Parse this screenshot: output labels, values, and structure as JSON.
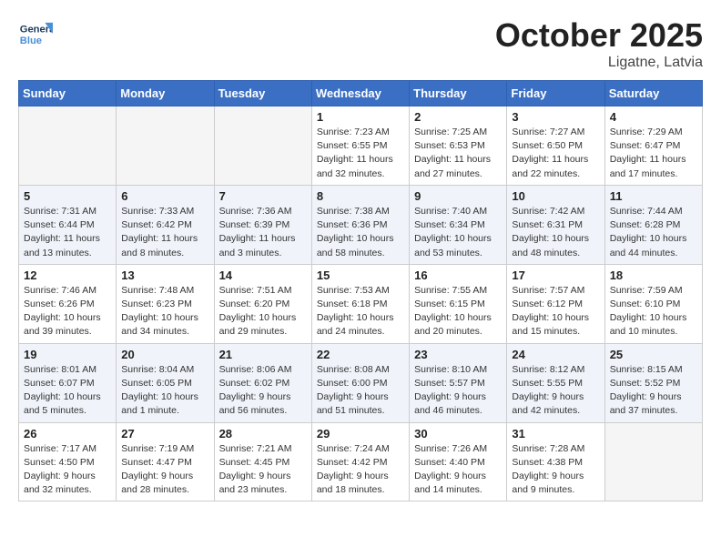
{
  "header": {
    "logo_general": "General",
    "logo_blue": "Blue",
    "month": "October 2025",
    "location": "Ligatne, Latvia"
  },
  "weekdays": [
    "Sunday",
    "Monday",
    "Tuesday",
    "Wednesday",
    "Thursday",
    "Friday",
    "Saturday"
  ],
  "weeks": [
    [
      {
        "day": "",
        "info": ""
      },
      {
        "day": "",
        "info": ""
      },
      {
        "day": "",
        "info": ""
      },
      {
        "day": "1",
        "info": "Sunrise: 7:23 AM\nSunset: 6:55 PM\nDaylight: 11 hours\nand 32 minutes."
      },
      {
        "day": "2",
        "info": "Sunrise: 7:25 AM\nSunset: 6:53 PM\nDaylight: 11 hours\nand 27 minutes."
      },
      {
        "day": "3",
        "info": "Sunrise: 7:27 AM\nSunset: 6:50 PM\nDaylight: 11 hours\nand 22 minutes."
      },
      {
        "day": "4",
        "info": "Sunrise: 7:29 AM\nSunset: 6:47 PM\nDaylight: 11 hours\nand 17 minutes."
      }
    ],
    [
      {
        "day": "5",
        "info": "Sunrise: 7:31 AM\nSunset: 6:44 PM\nDaylight: 11 hours\nand 13 minutes."
      },
      {
        "day": "6",
        "info": "Sunrise: 7:33 AM\nSunset: 6:42 PM\nDaylight: 11 hours\nand 8 minutes."
      },
      {
        "day": "7",
        "info": "Sunrise: 7:36 AM\nSunset: 6:39 PM\nDaylight: 11 hours\nand 3 minutes."
      },
      {
        "day": "8",
        "info": "Sunrise: 7:38 AM\nSunset: 6:36 PM\nDaylight: 10 hours\nand 58 minutes."
      },
      {
        "day": "9",
        "info": "Sunrise: 7:40 AM\nSunset: 6:34 PM\nDaylight: 10 hours\nand 53 minutes."
      },
      {
        "day": "10",
        "info": "Sunrise: 7:42 AM\nSunset: 6:31 PM\nDaylight: 10 hours\nand 48 minutes."
      },
      {
        "day": "11",
        "info": "Sunrise: 7:44 AM\nSunset: 6:28 PM\nDaylight: 10 hours\nand 44 minutes."
      }
    ],
    [
      {
        "day": "12",
        "info": "Sunrise: 7:46 AM\nSunset: 6:26 PM\nDaylight: 10 hours\nand 39 minutes."
      },
      {
        "day": "13",
        "info": "Sunrise: 7:48 AM\nSunset: 6:23 PM\nDaylight: 10 hours\nand 34 minutes."
      },
      {
        "day": "14",
        "info": "Sunrise: 7:51 AM\nSunset: 6:20 PM\nDaylight: 10 hours\nand 29 minutes."
      },
      {
        "day": "15",
        "info": "Sunrise: 7:53 AM\nSunset: 6:18 PM\nDaylight: 10 hours\nand 24 minutes."
      },
      {
        "day": "16",
        "info": "Sunrise: 7:55 AM\nSunset: 6:15 PM\nDaylight: 10 hours\nand 20 minutes."
      },
      {
        "day": "17",
        "info": "Sunrise: 7:57 AM\nSunset: 6:12 PM\nDaylight: 10 hours\nand 15 minutes."
      },
      {
        "day": "18",
        "info": "Sunrise: 7:59 AM\nSunset: 6:10 PM\nDaylight: 10 hours\nand 10 minutes."
      }
    ],
    [
      {
        "day": "19",
        "info": "Sunrise: 8:01 AM\nSunset: 6:07 PM\nDaylight: 10 hours\nand 5 minutes."
      },
      {
        "day": "20",
        "info": "Sunrise: 8:04 AM\nSunset: 6:05 PM\nDaylight: 10 hours\nand 1 minute."
      },
      {
        "day": "21",
        "info": "Sunrise: 8:06 AM\nSunset: 6:02 PM\nDaylight: 9 hours\nand 56 minutes."
      },
      {
        "day": "22",
        "info": "Sunrise: 8:08 AM\nSunset: 6:00 PM\nDaylight: 9 hours\nand 51 minutes."
      },
      {
        "day": "23",
        "info": "Sunrise: 8:10 AM\nSunset: 5:57 PM\nDaylight: 9 hours\nand 46 minutes."
      },
      {
        "day": "24",
        "info": "Sunrise: 8:12 AM\nSunset: 5:55 PM\nDaylight: 9 hours\nand 42 minutes."
      },
      {
        "day": "25",
        "info": "Sunrise: 8:15 AM\nSunset: 5:52 PM\nDaylight: 9 hours\nand 37 minutes."
      }
    ],
    [
      {
        "day": "26",
        "info": "Sunrise: 7:17 AM\nSunset: 4:50 PM\nDaylight: 9 hours\nand 32 minutes."
      },
      {
        "day": "27",
        "info": "Sunrise: 7:19 AM\nSunset: 4:47 PM\nDaylight: 9 hours\nand 28 minutes."
      },
      {
        "day": "28",
        "info": "Sunrise: 7:21 AM\nSunset: 4:45 PM\nDaylight: 9 hours\nand 23 minutes."
      },
      {
        "day": "29",
        "info": "Sunrise: 7:24 AM\nSunset: 4:42 PM\nDaylight: 9 hours\nand 18 minutes."
      },
      {
        "day": "30",
        "info": "Sunrise: 7:26 AM\nSunset: 4:40 PM\nDaylight: 9 hours\nand 14 minutes."
      },
      {
        "day": "31",
        "info": "Sunrise: 7:28 AM\nSunset: 4:38 PM\nDaylight: 9 hours\nand 9 minutes."
      },
      {
        "day": "",
        "info": ""
      }
    ]
  ]
}
